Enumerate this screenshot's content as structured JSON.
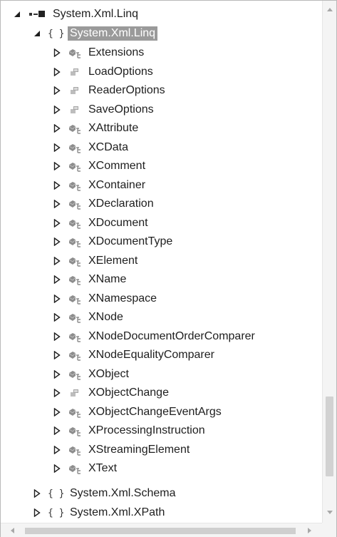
{
  "tree": {
    "root": {
      "label": "System.Xml.Linq",
      "icon": "assembly-icon"
    },
    "namespace": {
      "label": "System.Xml.Linq",
      "icon": "namespace-braces-icon",
      "glyph": "{ }"
    },
    "types": [
      {
        "label": "Extensions",
        "icon": "class-icon"
      },
      {
        "label": "LoadOptions",
        "icon": "enum-icon"
      },
      {
        "label": "ReaderOptions",
        "icon": "enum-icon"
      },
      {
        "label": "SaveOptions",
        "icon": "enum-icon"
      },
      {
        "label": "XAttribute",
        "icon": "class-icon"
      },
      {
        "label": "XCData",
        "icon": "class-icon"
      },
      {
        "label": "XComment",
        "icon": "class-icon"
      },
      {
        "label": "XContainer",
        "icon": "class-icon"
      },
      {
        "label": "XDeclaration",
        "icon": "class-icon"
      },
      {
        "label": "XDocument",
        "icon": "class-icon"
      },
      {
        "label": "XDocumentType",
        "icon": "class-icon"
      },
      {
        "label": "XElement",
        "icon": "class-icon"
      },
      {
        "label": "XName",
        "icon": "class-icon"
      },
      {
        "label": "XNamespace",
        "icon": "class-icon"
      },
      {
        "label": "XNode",
        "icon": "class-icon"
      },
      {
        "label": "XNodeDocumentOrderComparer",
        "icon": "class-icon"
      },
      {
        "label": "XNodeEqualityComparer",
        "icon": "class-icon"
      },
      {
        "label": "XObject",
        "icon": "class-icon"
      },
      {
        "label": "XObjectChange",
        "icon": "enum-icon"
      },
      {
        "label": "XObjectChangeEventArgs",
        "icon": "class-icon"
      },
      {
        "label": "XProcessingInstruction",
        "icon": "class-icon"
      },
      {
        "label": "XStreamingElement",
        "icon": "class-icon"
      },
      {
        "label": "XText",
        "icon": "class-icon"
      }
    ],
    "sibling_namespaces": [
      {
        "label": "System.Xml.Schema",
        "glyph": "{ }"
      },
      {
        "label": "System.Xml.XPath",
        "glyph": "{ }"
      }
    ]
  },
  "colors": {
    "selection": "#9a9a9a",
    "text": "#1e1e1e",
    "scroll_track": "#f4f4f4",
    "scroll_thumb": "#cfcfcf"
  }
}
